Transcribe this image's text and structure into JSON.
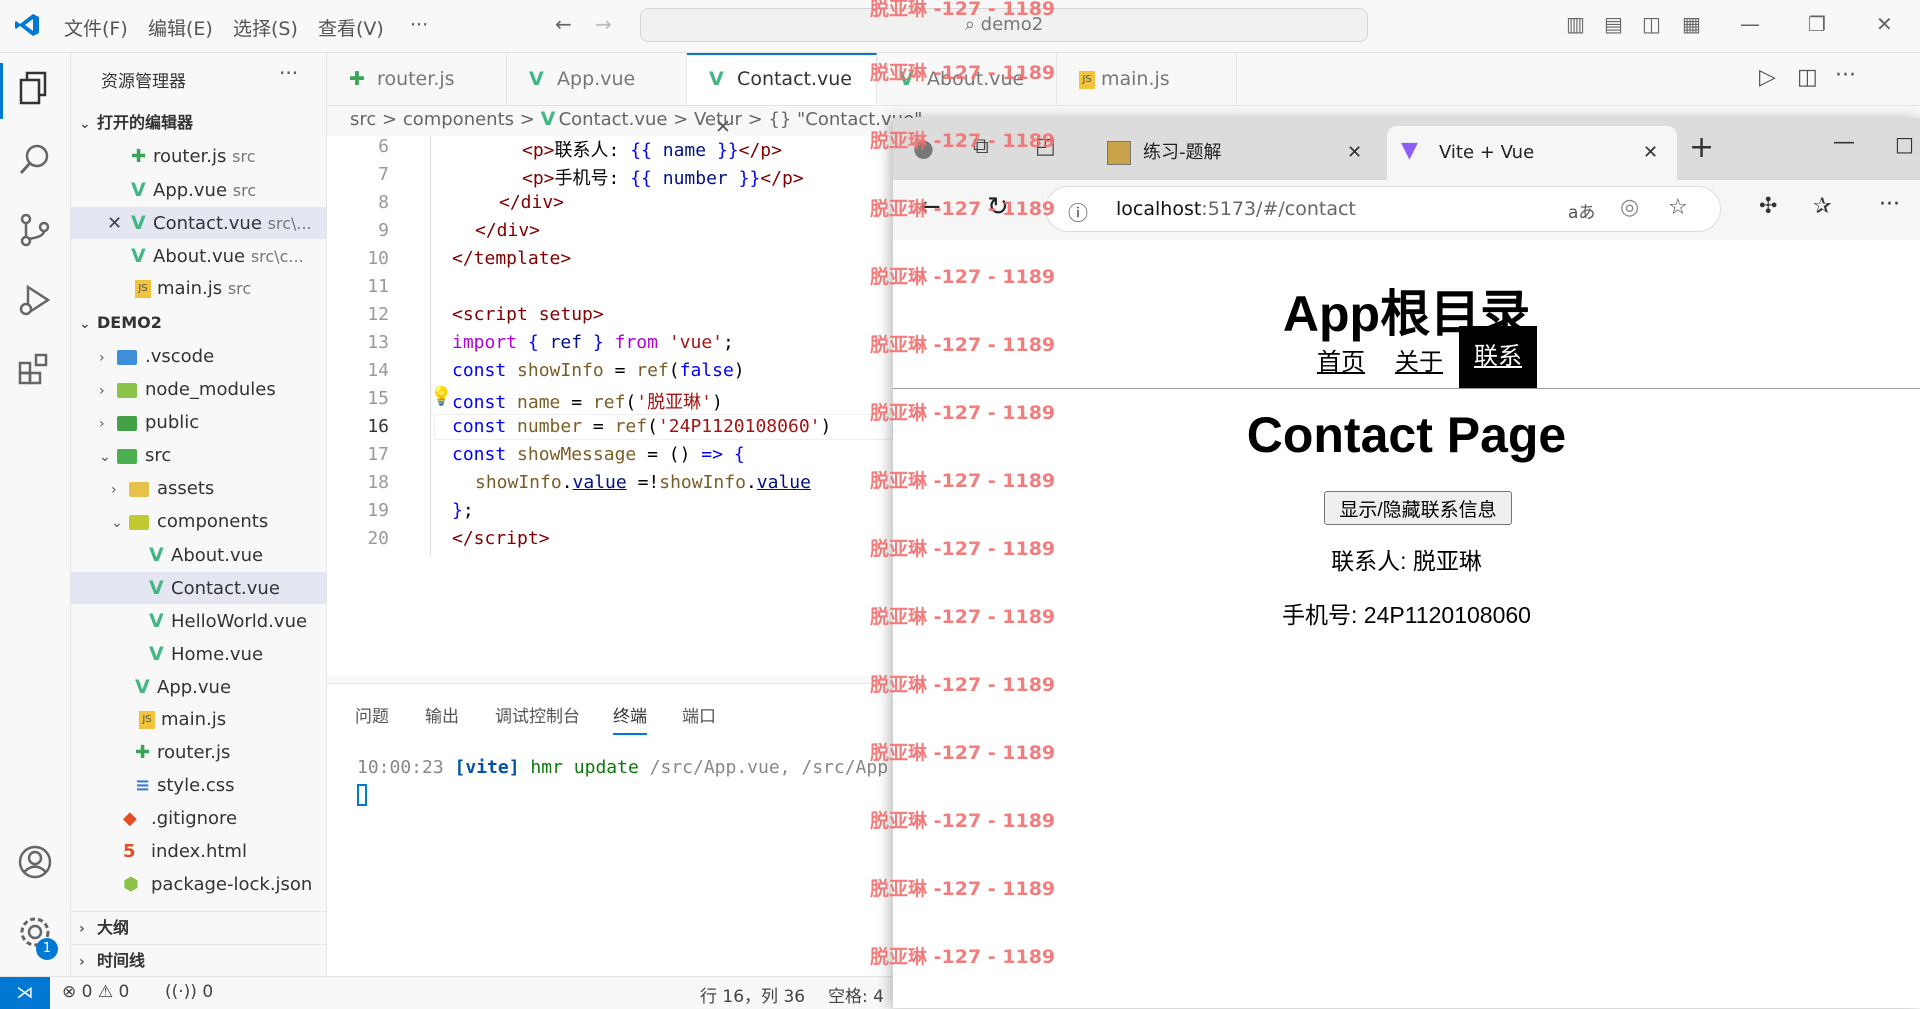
{
  "menu": {
    "file": "文件(F)",
    "edit": "编辑(E)",
    "select": "选择(S)",
    "view": "查看(V)",
    "more": "···"
  },
  "command_center": {
    "text": "demo2"
  },
  "sidebar": {
    "title": "资源管理器",
    "open_editors_label": "打开的编辑器",
    "open_editors": [
      {
        "name": "router.js",
        "desc": "src"
      },
      {
        "name": "App.vue",
        "desc": "src"
      },
      {
        "name": "Contact.vue",
        "desc": "src\\..."
      },
      {
        "name": "About.vue",
        "desc": "src\\c..."
      },
      {
        "name": "main.js",
        "desc": "src"
      }
    ],
    "project_label": "DEMO2",
    "tree": [
      ".vscode",
      "node_modules",
      "public",
      "src",
      "assets",
      "components",
      "About.vue",
      "Contact.vue",
      "HelloWorld.vue",
      "Home.vue",
      "App.vue",
      "main.js",
      "router.js",
      "style.css",
      ".gitignore",
      "index.html",
      "package-lock.json"
    ],
    "outline_label": "大纲",
    "timeline_label": "时间线"
  },
  "tabs": [
    "router.js",
    "App.vue",
    "Contact.vue",
    "About.vue",
    "main.js"
  ],
  "breadcrumb": {
    "p1": "src",
    "p2": "components",
    "p3": "Contact.vue",
    "p4": "Vetur",
    "p5": "{} \"Contact.vue\""
  },
  "code_lines": [
    {
      "n": "6"
    },
    {
      "n": "7"
    },
    {
      "n": "8"
    },
    {
      "n": "9"
    },
    {
      "n": "10"
    },
    {
      "n": "11"
    },
    {
      "n": "12"
    },
    {
      "n": "13"
    },
    {
      "n": "14"
    },
    {
      "n": "15"
    },
    {
      "n": "16"
    },
    {
      "n": "17"
    },
    {
      "n": "18"
    },
    {
      "n": "19"
    },
    {
      "n": "20"
    }
  ],
  "panel": {
    "tabs": [
      "问题",
      "输出",
      "调试控制台",
      "终端",
      "端口"
    ],
    "log_time": "10:00:23",
    "log_tag": "[vite]",
    "log_msg": "hmr update",
    "log_path": "/src/App.vue, /src/App"
  },
  "status": {
    "errors": "0",
    "warnings": "0",
    "ports": "0",
    "position": "行 16，列 36",
    "spaces": "空格: 4"
  },
  "browser": {
    "tab1": "练习-题解",
    "tab2": "Vite + Vue",
    "url_host": "localhost",
    "url_rest": ":5173/#/contact",
    "page": {
      "heading": "App根目录",
      "nav": [
        "首页",
        "关于",
        "联系"
      ],
      "title": "Contact Page",
      "button": "显示/隐藏联系信息",
      "contact_line": "联系人: 脱亚琳",
      "phone_line": "手机号: 24P1120108060"
    }
  },
  "watermark": "脱亚琳 -127 - 1189",
  "badge": "1"
}
